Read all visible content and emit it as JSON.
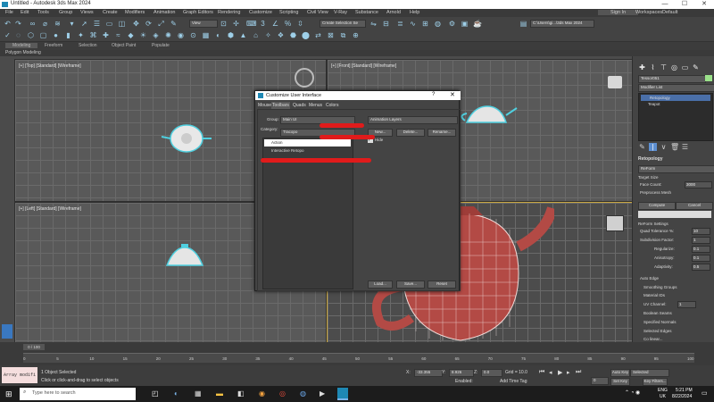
{
  "window": {
    "title": "Untitled - Autodesk 3ds Max 2024",
    "minimize": "—",
    "maximize": "☐",
    "close": "✕"
  },
  "menu": [
    "File",
    "Edit",
    "Tools",
    "Group",
    "Views",
    "Create",
    "Modifiers",
    "Animation",
    "Graph Editors",
    "Rendering",
    "Customize",
    "Scripting",
    "Civil View",
    "V-Ray",
    "Substance",
    "Arnold",
    "Help"
  ],
  "account": {
    "sign_in": "Sign In",
    "workspaces_label": "Workspaces:",
    "workspace_value": "Default"
  },
  "toolbar": {
    "view_dropdown": "View",
    "selection_set": "Create Selection Se",
    "path": "C:\\Users\\gi...\\3ds Max 2024"
  },
  "ribbon_tabs": [
    "Modeling",
    "Freeform",
    "Selection",
    "Object Paint",
    "Populate"
  ],
  "ribbon_sub": "Polygon Modeling",
  "viewports": {
    "top": "[+] [Top] [Standard] [Wireframe]",
    "front": "[+] [Front] [Standard] [Wireframe]",
    "left": "[+] [Left] [Standard] [Wireframe]",
    "perspective": ""
  },
  "dialog": {
    "title": "Customize User Interface",
    "help": "?",
    "tabs": [
      "Mouse",
      "Toolbars",
      "Quads",
      "Menus",
      "Colors"
    ],
    "group_label": "Group:",
    "group_value": "Main UI",
    "category_label": "Category:",
    "category_value": "Tracopo",
    "list_items": [
      "Action",
      "Interactive Retopo"
    ],
    "toolbar_list_value": "Animation Layers",
    "buttons": {
      "new": "New...",
      "delete": "Delete...",
      "rename": "Rename..."
    },
    "hide_label": "Hide",
    "bottom_buttons": {
      "load": "Load...",
      "save": "Save...",
      "reset": "Reset"
    }
  },
  "command_panel": {
    "object_name": "Tessor051",
    "modifier_list": "Modifier List",
    "stack": [
      "Retopology",
      "Teapot"
    ],
    "rollout_title": "Retopology",
    "reform": "ReForm",
    "target_size": "Target Size",
    "face_count_label": "Face Count:",
    "face_count_value": "3000",
    "preprocess": "Preprocess Mesh",
    "compute": "Compute",
    "cancel": "Cancel",
    "reform_settings": "ReForm Settings",
    "quad_tol_label": "Quad Tolerance %:",
    "quad_tol_value": "10",
    "subdiv_label": "Subdivision Factor:",
    "subdiv_value": "1",
    "regularize_label": "Regularize:",
    "regularize_value": "0.1",
    "anisotropy_label": "Anisotropy:",
    "anisotropy_value": "0.1",
    "adaptivity_label": "Adaptivity:",
    "adaptivity_value": "0.5",
    "auto_edge": "Auto Edge",
    "smoothing_groups": "Smoothing Groups",
    "material_ids": "Material IDs",
    "uv_channel_label": "UV Channel:",
    "uv_channel_value": "1",
    "boolean_seams": "Boolean Seams",
    "specified_normals": "Specified Normals",
    "selected_edges": "Selected Edges",
    "edge_loop": "Co linear..."
  },
  "timeline": {
    "frame": "0 / 100",
    "ticks": [
      "0",
      "5",
      "10",
      "15",
      "20",
      "25",
      "30",
      "35",
      "40",
      "45",
      "50",
      "55",
      "60",
      "65",
      "70",
      "75",
      "80",
      "85",
      "90",
      "95",
      "100"
    ]
  },
  "status": {
    "script_box": "Array modifi",
    "selected": "1 Object Selected",
    "prompt": "Click or click-and-drag to select objects",
    "x_label": "X:",
    "x_value": "-33.355",
    "y_label": "Y:",
    "y_value": "8.926",
    "z_label": "Z:",
    "z_value": "0.0",
    "grid": "Grid = 10.0",
    "enabled": "Enabled:",
    "add_time_tag": "Add Time Tag",
    "auto_key": "Auto Key",
    "set_key": "Set Key",
    "selected_dd": "Selected",
    "key_filters": "Key Filters...",
    "frame_value": "0"
  },
  "taskbar": {
    "search_placeholder": "Type here to search",
    "lang": "ENG",
    "region": "UK",
    "time": "5:21 PM",
    "date": "8/22/2024"
  }
}
